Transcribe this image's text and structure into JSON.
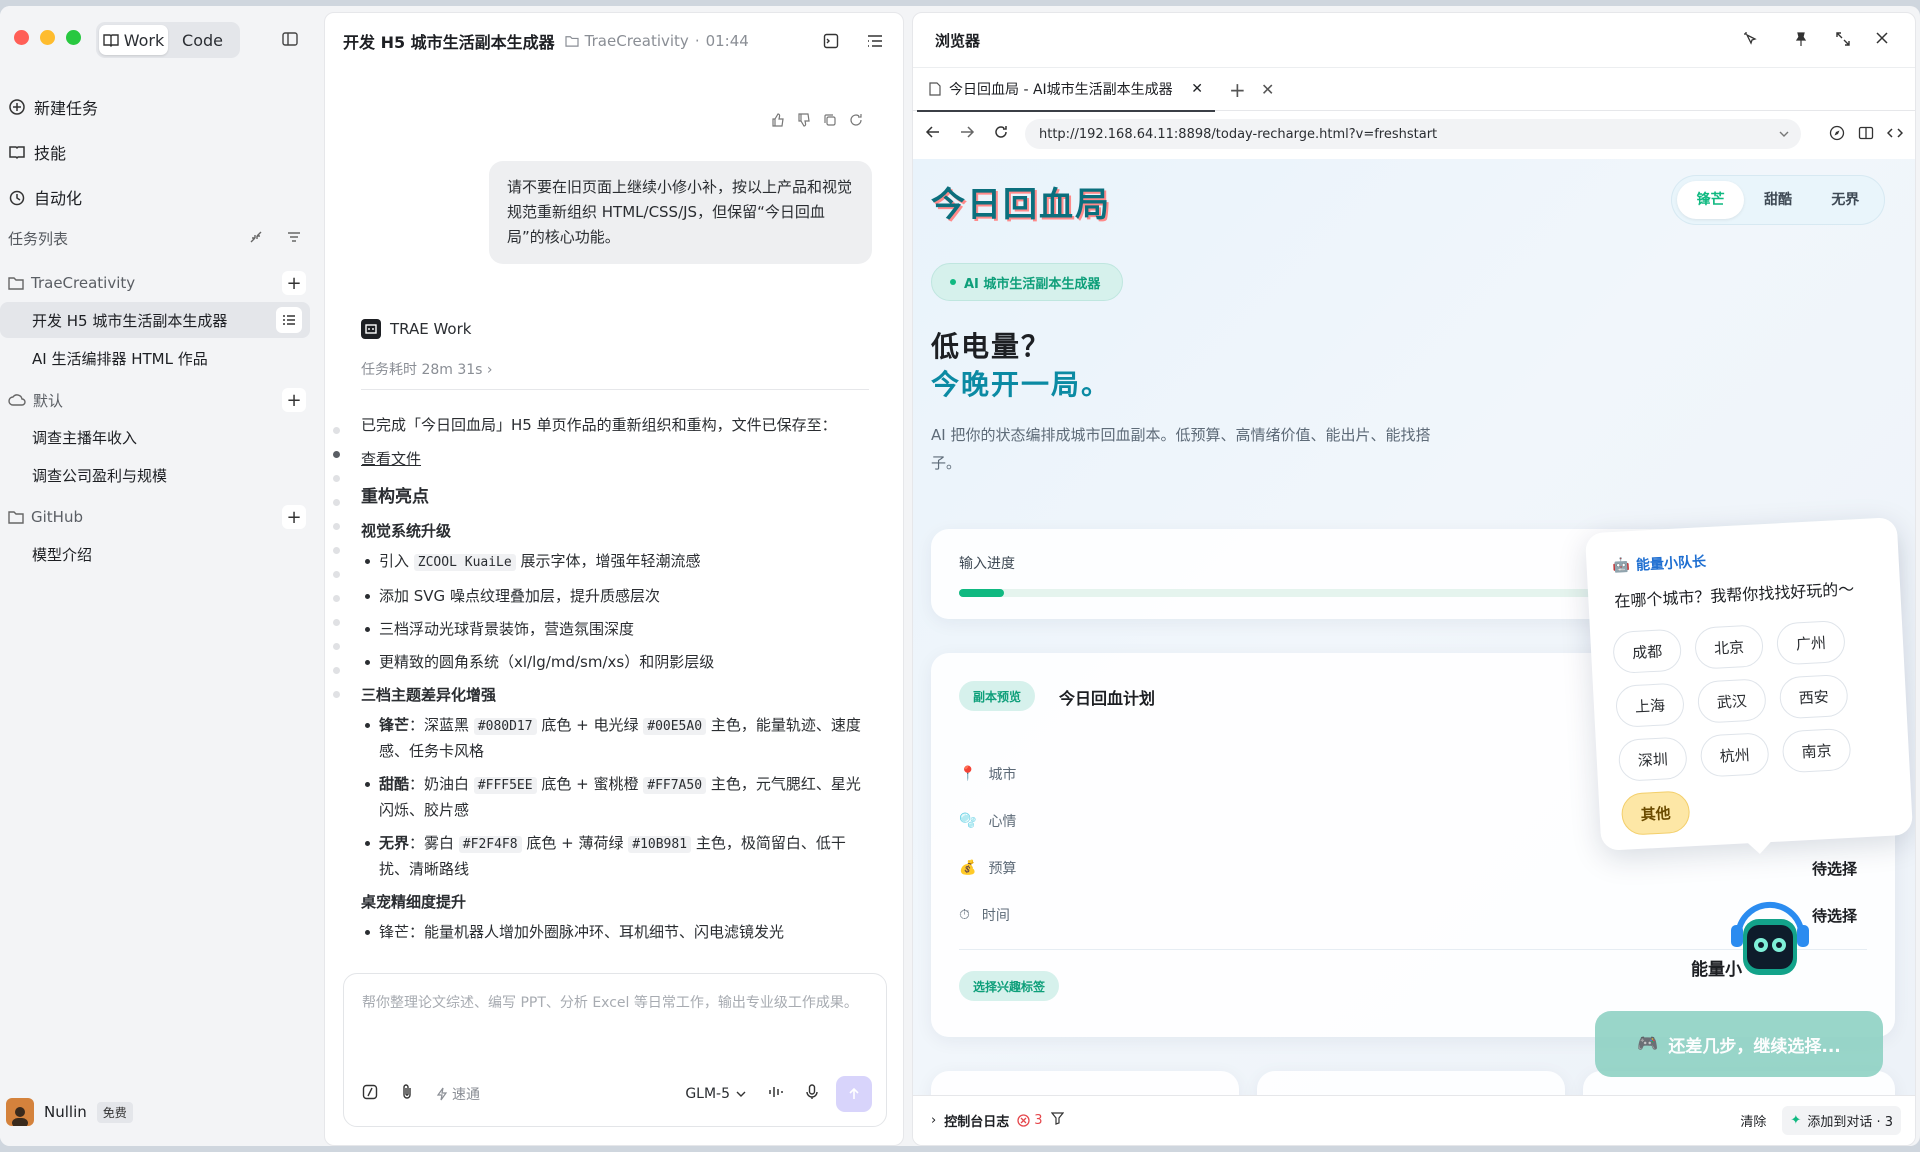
{
  "window": {
    "mode_tabs": [
      {
        "label": "Work"
      },
      {
        "label": "Code"
      }
    ]
  },
  "sidebar": {
    "nav": [
      {
        "label": "新建任务"
      },
      {
        "label": "技能"
      },
      {
        "label": "自动化"
      }
    ],
    "tasks_header": "任务列表",
    "groups": [
      {
        "name": "TraeCreativity",
        "tasks": [
          "开发 H5 城市生活副本生成器",
          "AI 生活编排器 HTML 作品"
        ]
      },
      {
        "name": "默认",
        "tasks": [
          "调查主播年收入",
          "调查公司盈利与规模"
        ]
      },
      {
        "name": "GitHub",
        "tasks": [
          "模型介绍"
        ]
      }
    ],
    "user": {
      "name": "Nullin",
      "plan": "免费"
    }
  },
  "chat": {
    "title": "开发 H5 城市生活副本生成器",
    "project": "TraeCreativity",
    "time": "01:44",
    "user_message": "请不要在旧页面上继续小修小补，按以上产品和视觉规范重新组织 HTML/CSS/JS，但保留“今日回血局”的核心功能。",
    "agent_name": "TRAE Work",
    "duration": "任务耗时 28m 31s",
    "summary": "已完成「今日回血局」H5 单页作品的重新组织和重构，文件已保存至：",
    "view_file": "查看文件",
    "h_highlights": "重构亮点",
    "h_visual": "视觉系统升级",
    "visual_items": [
      {
        "pre": "引入 ",
        "code": "ZCOOL KuaiLe",
        "post": " 展示字体，增强年轻潮流感"
      },
      {
        "pre": "添加 SVG 噪点纹理叠加层，提升质感层次",
        "code": "",
        "post": ""
      },
      {
        "pre": "三档浮动光球背景装饰，营造氛围深度",
        "code": "",
        "post": ""
      },
      {
        "pre": "更精致的圆角系统（xl/lg/md/sm/xs）和阴影层级",
        "code": "",
        "post": ""
      }
    ],
    "h_theme": "三档主题差异化增强",
    "theme_items": [
      {
        "name": "锋芒",
        "t1": "：深蓝黑 ",
        "c1": "#080D17",
        "t2": " 底色 + 电光绿 ",
        "c2": "#00E5A0",
        "t3": " 主色，能量轨迹、速度感、任务卡风格"
      },
      {
        "name": "甜酷",
        "t1": "：奶油白 ",
        "c1": "#FFF5EE",
        "t2": " 底色 + 蜜桃橙 ",
        "c2": "#FF7A50",
        "t3": " 主色，元气腮红、星光闪烁、胶片感"
      },
      {
        "name": "无界",
        "t1": "：雾白 ",
        "c1": "#F2F4F8",
        "t2": " 底色 + 薄荷绿 ",
        "c2": "#10B981",
        "t3": " 主色，极简留白、低干扰、清晰路线"
      }
    ],
    "h_pet": "桌宠精细度提升",
    "pet_partial": "锋芒：能量机器人增加外圈脉冲环、耳机细节、闪电滤镜发光",
    "composer_placeholder": "帮你整理论文综述、编写 PPT、分析 Excel 等日常工作，输出专业级工作成果。",
    "speed_label": "速通",
    "model": "GLM-5"
  },
  "browser": {
    "title": "浏览器",
    "tab_title": "今日回血局 - AI城市生活副本生成器",
    "url": "http://192.168.64.11:8898/today-recharge.html?v=freshstart",
    "page": {
      "brand": "今日回血局",
      "themes": [
        {
          "label": "锋芒",
          "active": true
        },
        {
          "label": "甜酷",
          "active": false
        },
        {
          "label": "无界",
          "active": false
        }
      ],
      "pill": "AI 城市生活副本生成器",
      "hero_line1": "低电量？",
      "hero_line2": "今晚开一局。",
      "description": "AI 把你的状态编排成城市回血副本。低预算、高情绪价值、能出片、能找搭子。",
      "progress_label": "输入进度",
      "progress_value": 0.05,
      "plan_tag": "副本预览",
      "plan_title": "今日回血计划",
      "rows": [
        {
          "icon": "📍",
          "label": "城市",
          "value": ""
        },
        {
          "icon": "🫧",
          "label": "心情",
          "value": ""
        },
        {
          "icon": "💰",
          "label": "预算",
          "value": "待选择"
        },
        {
          "icon": "⏱",
          "label": "时间",
          "value": "待选择"
        }
      ],
      "interest_tag": "选择兴趣标签",
      "popup": {
        "title": "能量小队长",
        "question": "在哪个城市？我帮你找找好玩的～",
        "cities": [
          "成都",
          "北京",
          "广州",
          "上海",
          "武汉",
          "西安",
          "深圳",
          "杭州",
          "南京",
          "其他"
        ]
      },
      "robot_label": "能量小",
      "cta": "还差几步，继续选择..."
    },
    "console": {
      "label": "控制台日志",
      "errors": "3",
      "clear": "清除",
      "add": "添加到对话 · 3"
    }
  },
  "colors": {
    "accent": "#10b981",
    "brand": "#0b6f7d",
    "send": "#d8d4fb"
  }
}
